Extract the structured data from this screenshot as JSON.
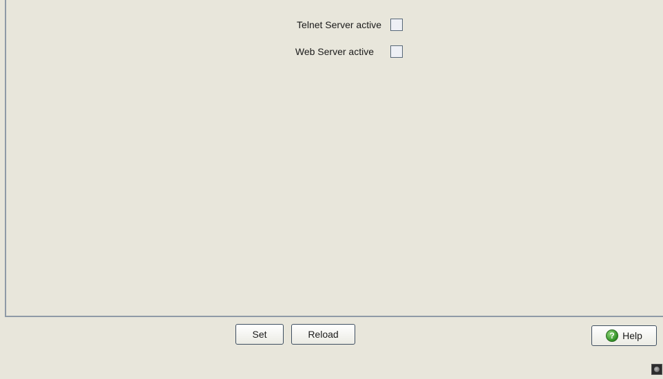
{
  "form": {
    "telnet": {
      "label": "Telnet Server active",
      "checked": false
    },
    "web": {
      "label": "Web Server active",
      "checked": false
    }
  },
  "buttons": {
    "set_label": "Set",
    "reload_label": "Reload",
    "help_label": "Help",
    "help_icon_glyph": "?"
  },
  "icons": {
    "help": "help-icon",
    "status": "status-indicator-icon"
  },
  "colors": {
    "background": "#e8e6db",
    "border": "#8e9aa6",
    "help_icon": "#2f8f24"
  }
}
